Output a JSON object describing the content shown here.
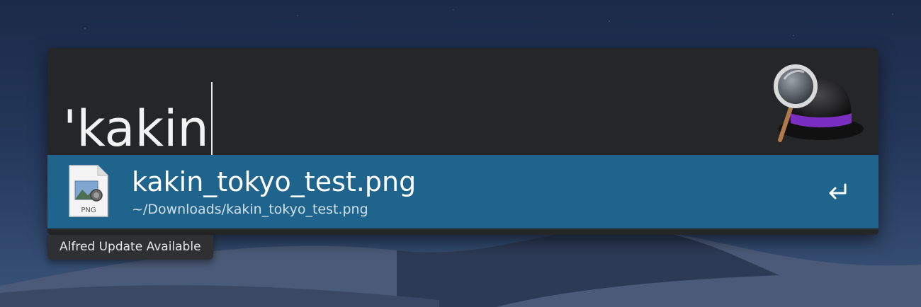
{
  "search": {
    "query": "'kakin"
  },
  "app": {
    "logo_icon": "alfred-hat-magnifier-icon"
  },
  "results": [
    {
      "title": "kakin_tokyo_test.png",
      "subtitle": "~/Downloads/kakin_tokyo_test.png",
      "file_type_label": "PNG",
      "icon": "png-file-icon",
      "action_icon": "return-key-icon",
      "selected": true
    }
  ],
  "banner": {
    "text": "Alfred Update Available"
  },
  "colors": {
    "window_bg": "#252628",
    "selected_row": "#1f648d",
    "hat_band": "#7a2fc2"
  }
}
